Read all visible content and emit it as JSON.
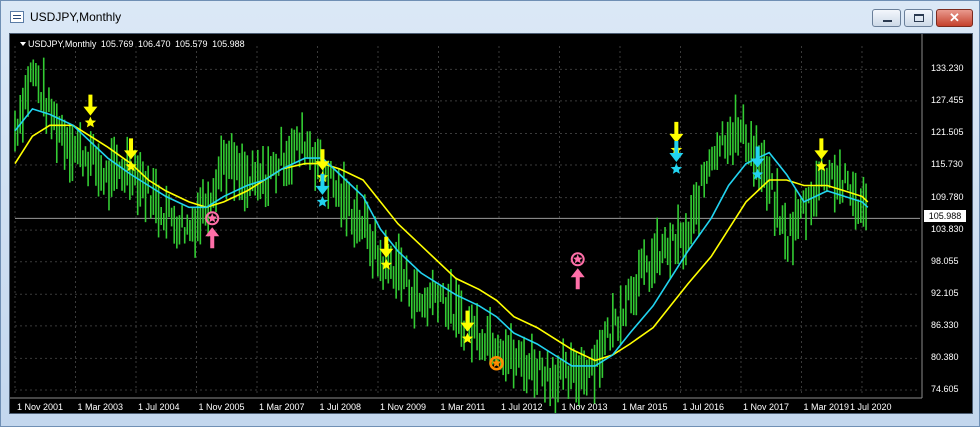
{
  "window": {
    "title": "USDJPY,Monthly",
    "min_icon": "minimize-icon",
    "max_icon": "maximize-icon",
    "close_icon": "close-icon"
  },
  "chart_header": {
    "symbol": "USDJPY,Monthly",
    "open": "105.769",
    "high": "106.470",
    "low": "105.579",
    "close": "105.988"
  },
  "current_price": "105.988",
  "colors": {
    "background": "#000000",
    "candles": "#33cc33",
    "ma_fast": "#22d3f0",
    "ma_slow": "#ffff00",
    "pink_signal": "#ff6fa8",
    "orange_signal": "#ff8c00"
  },
  "chart_data": {
    "type": "line",
    "instrument": "USDJPY",
    "timeframe": "Monthly",
    "x_labels": [
      "1 Nov 2001",
      "1 Mar 2003",
      "1 Jul 2004",
      "1 Nov 2005",
      "1 Mar 2007",
      "1 Jul 2008",
      "1 Nov 2009",
      "1 Mar 2011",
      "1 Jul 2012",
      "1 Nov 2013",
      "1 Mar 2015",
      "1 Jul 2016",
      "1 Nov 2017",
      "1 Mar 2019",
      "1 Jul 2020"
    ],
    "y_ticks": [
      "133.230",
      "127.455",
      "121.505",
      "115.730",
      "109.780",
      "103.830",
      "98.055",
      "92.105",
      "86.330",
      "80.380",
      "74.605"
    ],
    "ylim": [
      73.5,
      137.5
    ],
    "xlim": [
      0,
      15.6
    ],
    "price": {
      "x": [
        0,
        0.3,
        0.6,
        1,
        1.3,
        1.6,
        2,
        2.3,
        2.6,
        3,
        3.3,
        3.6,
        4,
        4.3,
        4.6,
        5,
        5.3,
        5.6,
        6,
        6.3,
        6.6,
        7,
        7.3,
        7.6,
        8,
        8.3,
        8.6,
        9,
        9.3,
        9.6,
        10,
        10.3,
        10.6,
        11,
        11.3,
        11.6,
        12,
        12.3,
        12.6,
        13,
        13.3,
        13.6,
        14,
        14.3,
        14.6,
        14.7
      ],
      "y": [
        122,
        133,
        125,
        119,
        117,
        113,
        116,
        111,
        107,
        104,
        109,
        117,
        112,
        113,
        117,
        120,
        116,
        110,
        105,
        98,
        97,
        90,
        93,
        88,
        85,
        84,
        80,
        79,
        77,
        77,
        80,
        86,
        93,
        98,
        101,
        102,
        118,
        122,
        121,
        112,
        102,
        108,
        115,
        112,
        108,
        106
      ]
    },
    "ma_fast": {
      "x": [
        0,
        0.3,
        0.6,
        1,
        1.3,
        1.6,
        2,
        2.3,
        2.6,
        3,
        3.3,
        3.6,
        4,
        4.3,
        4.6,
        5,
        5.3,
        5.6,
        6,
        6.3,
        6.6,
        7,
        7.3,
        7.6,
        8,
        8.3,
        8.6,
        9,
        9.3,
        9.6,
        10,
        10.3,
        10.6,
        11,
        11.3,
        11.6,
        12,
        12.3,
        12.6,
        13,
        13.3,
        13.6,
        14,
        14.3,
        14.6,
        14.7
      ],
      "y": [
        122,
        126,
        125,
        123,
        120,
        117,
        114,
        112,
        110,
        108,
        108,
        110,
        112,
        113,
        115,
        117,
        117,
        114,
        110,
        104,
        100,
        96,
        94,
        92,
        90,
        88,
        85,
        83,
        81,
        79,
        79,
        81,
        85,
        90,
        95,
        100,
        106,
        112,
        116,
        118,
        114,
        109,
        111,
        110,
        109,
        108
      ]
    },
    "ma_slow": {
      "x": [
        0,
        0.3,
        0.6,
        1,
        1.3,
        1.6,
        2,
        2.3,
        2.6,
        3,
        3.3,
        3.6,
        4,
        4.3,
        4.6,
        5,
        5.3,
        5.6,
        6,
        6.3,
        6.6,
        7,
        7.3,
        7.6,
        8,
        8.3,
        8.6,
        9,
        9.3,
        9.6,
        10,
        10.3,
        10.6,
        11,
        11.3,
        11.6,
        12,
        12.3,
        12.6,
        13,
        13.3,
        13.6,
        14,
        14.3,
        14.6,
        14.7
      ],
      "y": [
        116,
        121,
        123,
        123,
        121,
        119,
        116,
        113,
        111,
        109,
        108,
        109,
        111,
        113,
        115,
        116,
        116,
        115,
        113,
        109,
        105,
        101,
        98,
        95,
        93,
        91,
        88,
        86,
        84,
        82,
        80,
        81,
        83,
        86,
        90,
        94,
        99,
        104,
        109,
        113,
        113,
        112,
        112,
        111,
        110,
        109
      ]
    },
    "signals": [
      {
        "x": 1.3,
        "y": 123.5,
        "type": "down-arrow",
        "color": "yellow"
      },
      {
        "x": 2.0,
        "y": 115.5,
        "type": "down-arrow",
        "color": "yellow"
      },
      {
        "x": 3.4,
        "y": 106,
        "type": "up-arrow",
        "color": "pink"
      },
      {
        "x": 5.3,
        "y": 113.5,
        "type": "down-arrow",
        "color": "yellow"
      },
      {
        "x": 5.3,
        "y": 109,
        "type": "down-arrow",
        "color": "cyan"
      },
      {
        "x": 6.4,
        "y": 97.5,
        "type": "down-arrow",
        "color": "yellow"
      },
      {
        "x": 7.8,
        "y": 84,
        "type": "down-arrow",
        "color": "yellow"
      },
      {
        "x": 8.3,
        "y": 79.5,
        "type": "circle",
        "color": "orange"
      },
      {
        "x": 9.7,
        "y": 98.5,
        "type": "up-arrow",
        "color": "pink"
      },
      {
        "x": 11.4,
        "y": 118.5,
        "type": "down-arrow",
        "color": "yellow"
      },
      {
        "x": 11.4,
        "y": 115,
        "type": "down-arrow",
        "color": "cyan"
      },
      {
        "x": 12.8,
        "y": 114,
        "type": "down-arrow",
        "color": "cyan"
      },
      {
        "x": 13.9,
        "y": 115.5,
        "type": "down-arrow",
        "color": "yellow"
      }
    ]
  }
}
